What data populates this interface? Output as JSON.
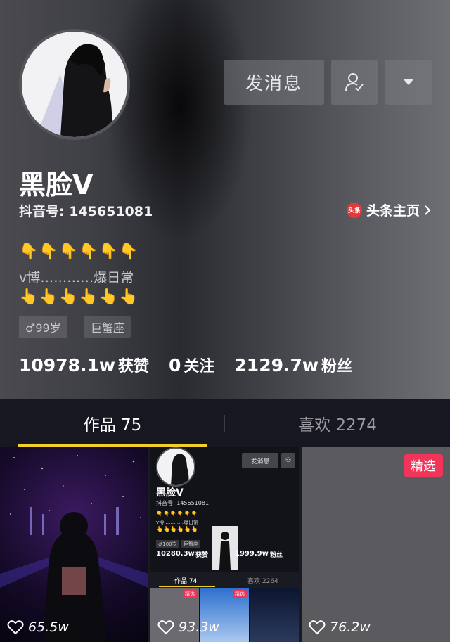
{
  "profile": {
    "name": "黑脸V",
    "douyin_id": "抖音号: 145651081",
    "toutiao_label": "头条主页",
    "toutiao_badge": "头条",
    "bio_line1": "👇👇👇👇👇👇",
    "bio_line2": "v博…………爆日常",
    "bio_line3": "👆👆👆👆👆👆",
    "tag_gender": "♂99岁",
    "tag_zodiac": "巨蟹座"
  },
  "actions": {
    "message_label": "发消息",
    "follow_icon": "user-check-icon",
    "more_icon": "caret-down-icon"
  },
  "stats": {
    "likes_value": "10978.1w",
    "likes_label": "获赞",
    "following_value": "0",
    "following_label": "关注",
    "fans_value": "2129.7w",
    "fans_label": "粉丝"
  },
  "tabs": {
    "works": "作品 75",
    "liked": "喜欢 2274",
    "active": "works"
  },
  "videos": [
    {
      "likes": "65.5w",
      "featured": false
    },
    {
      "likes": "93.3w",
      "featured": false
    },
    {
      "likes": "76.2w",
      "featured": true,
      "featured_label": "精选"
    }
  ],
  "mini_profile": {
    "message_label": "发消息",
    "name": "黑脸V",
    "douyin_id": "抖音号: 145651081",
    "bio_line1": "👇👇👇👇👇👇",
    "bio_line2": "v博…………爆日常",
    "bio_line3": "👆👆👆👆👆👆",
    "tag_gender": "♂100岁",
    "tag_zodiac": "巨蟹座",
    "likes_value": "10280.3w",
    "likes_label": "获赞",
    "fans_value": "1999.9w",
    "fans_label": "粉丝",
    "tab_works": "作品 74",
    "tab_liked": "喜欢 2264",
    "featured_label": "精选"
  },
  "colors": {
    "accent_underline": "#f4ce2a",
    "featured_badge": "#f0345a",
    "toutiao_red": "#e23a3a"
  }
}
